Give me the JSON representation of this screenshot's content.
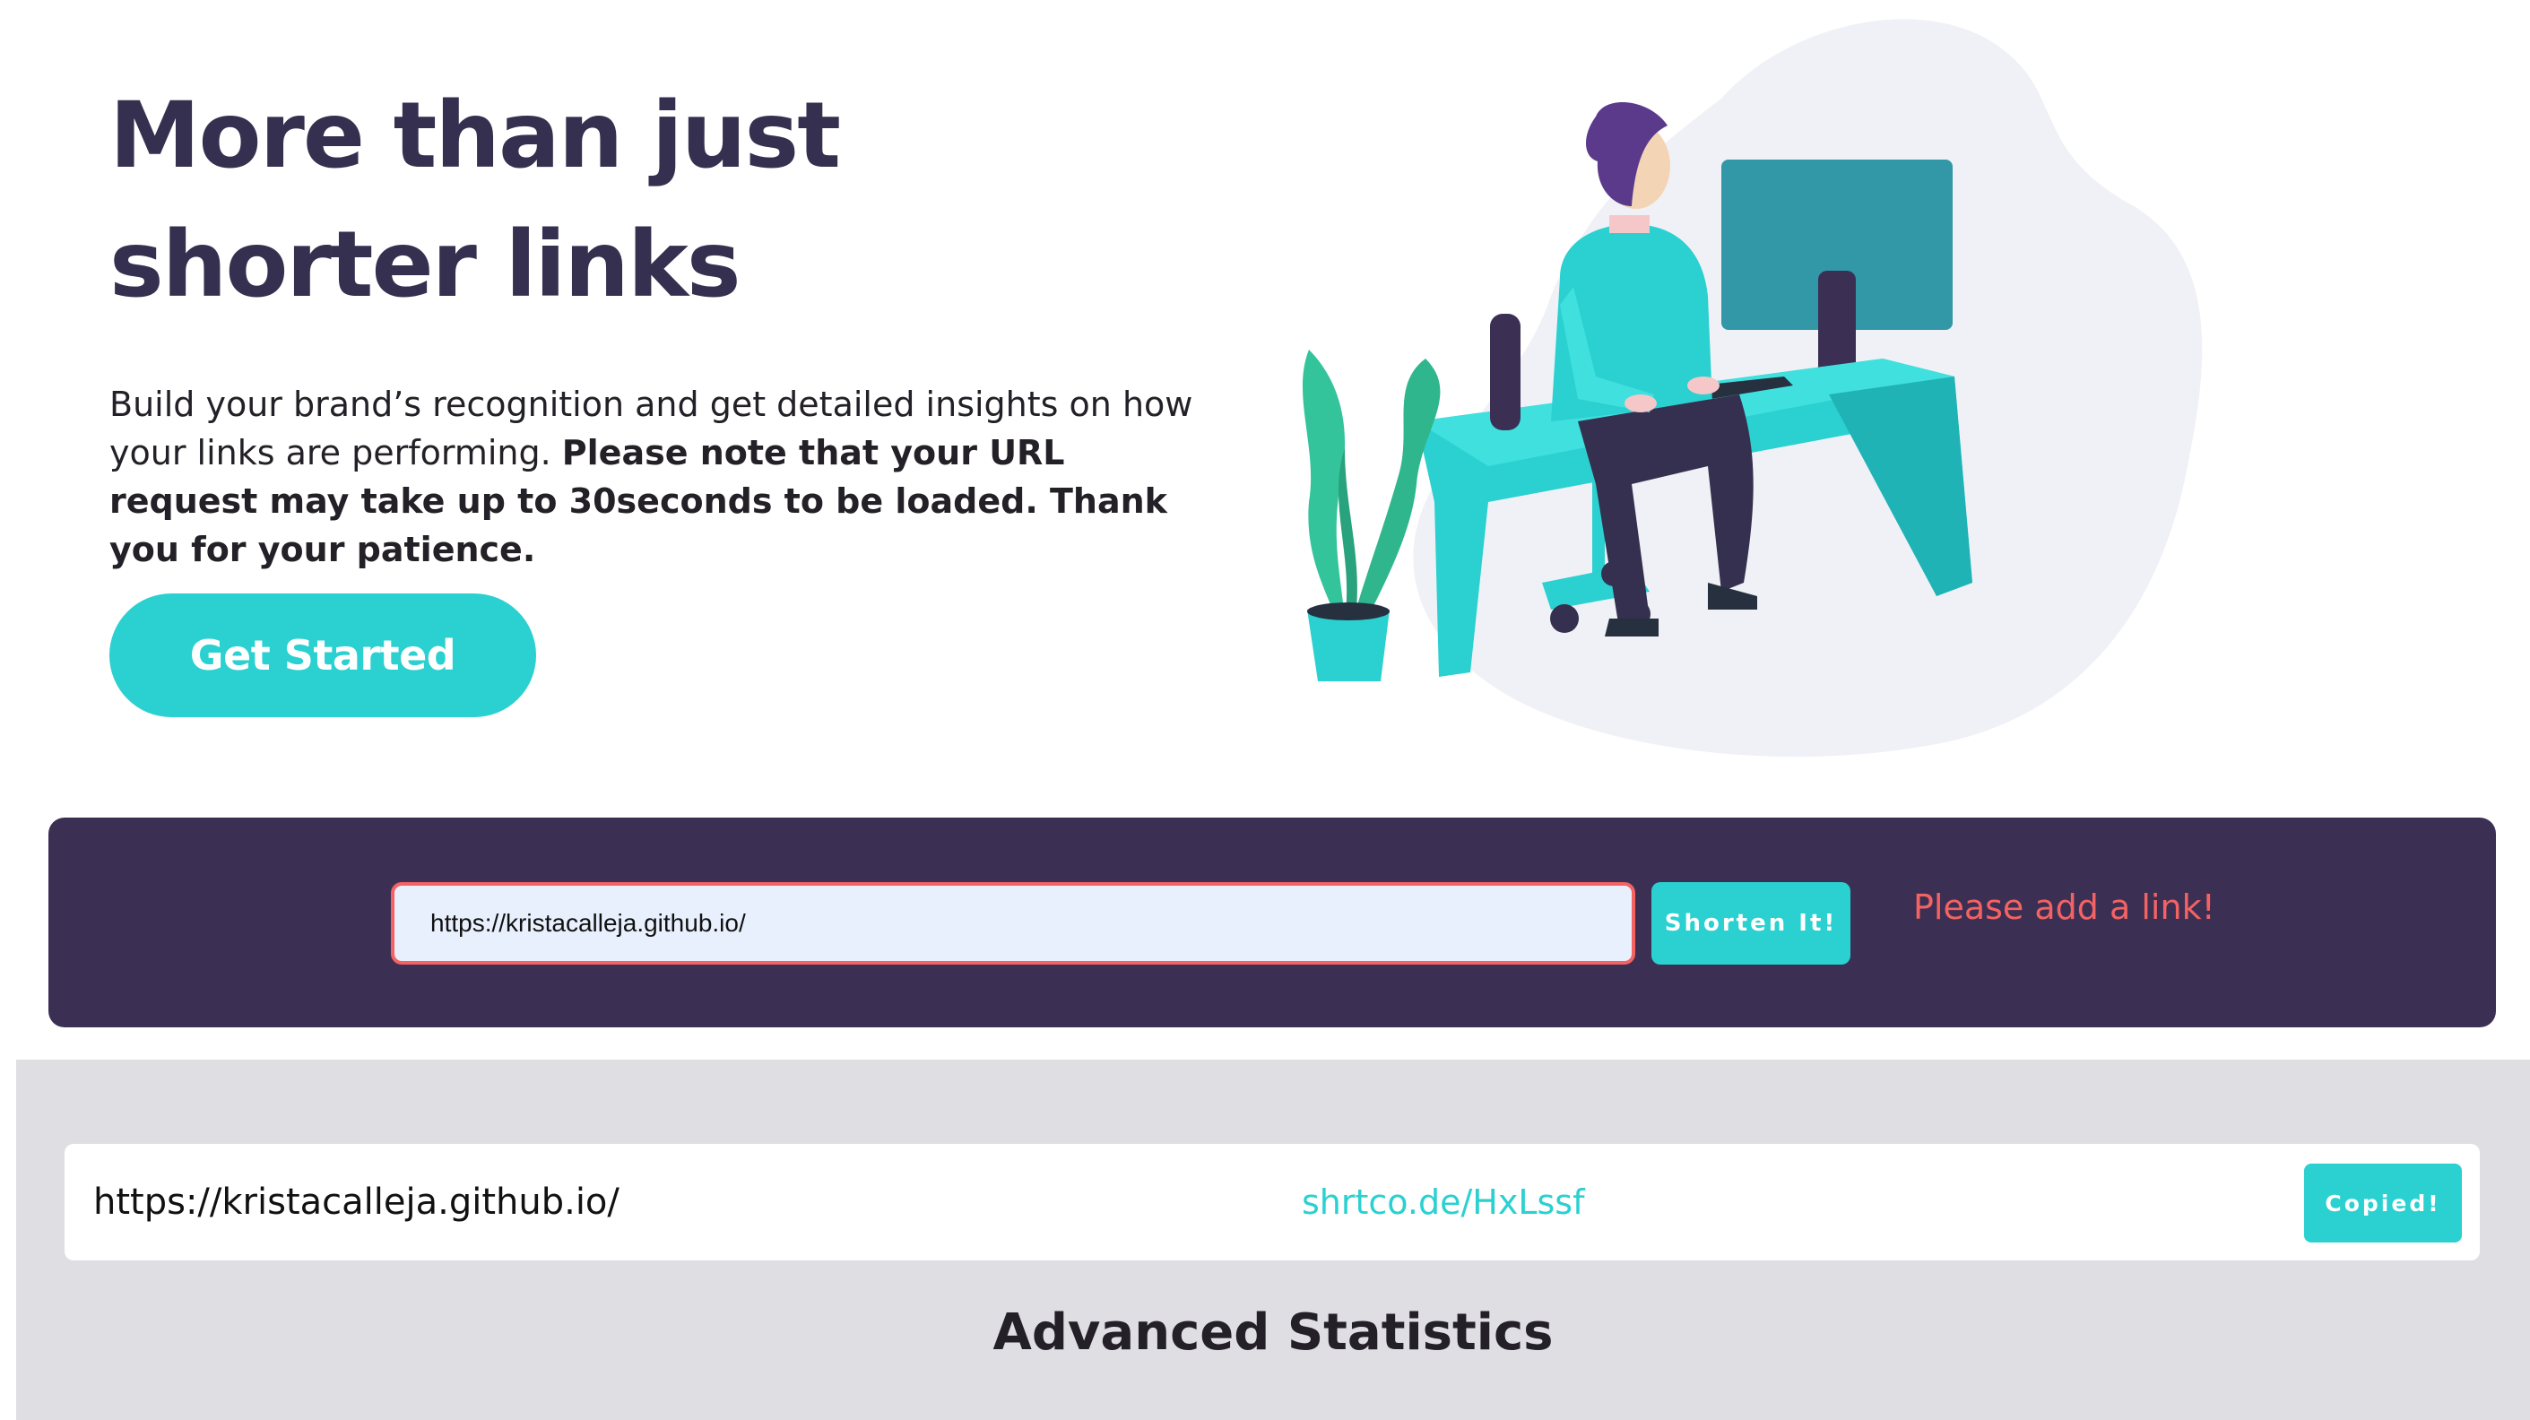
{
  "hero": {
    "title": "More than just shorter links",
    "description": "Build your brand’s recognition and get detailed insights on how your links are performing.",
    "note": "Please note that your URL request may take up to 30seconds to be loaded. Thank you for your patience.",
    "cta_label": "Get Started"
  },
  "illustration": {
    "icon": "person-working-at-desk-illustration"
  },
  "shorten": {
    "input_value": "https://kristacalleja.github.io/",
    "button_label": "Shorten It!",
    "error_text": "Please add a link!"
  },
  "results": [
    {
      "original": "https://kristacalleja.github.io/",
      "short": "shrtco.de/HxLssf",
      "button_label": "Copied!"
    }
  ],
  "stats": {
    "heading": "Advanced Statistics"
  },
  "colors": {
    "primary": "#2bd0d0",
    "dark_violet": "#3b3054",
    "heading": "#35304f",
    "error": "#f46262",
    "gray_bg": "#dfdee3"
  }
}
